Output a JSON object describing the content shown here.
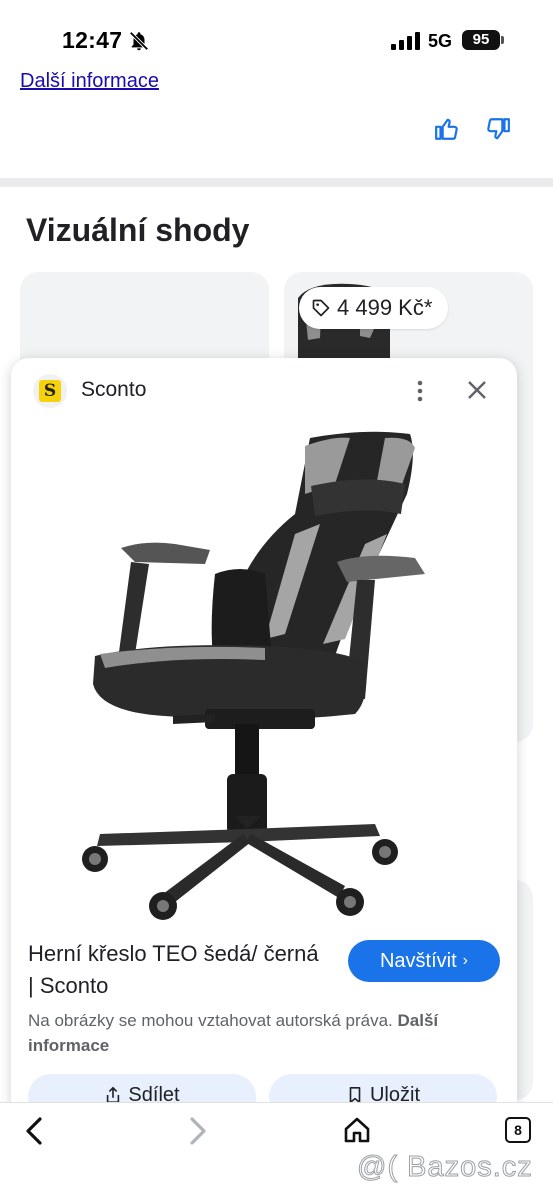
{
  "status_bar": {
    "time": "12:47",
    "network": "5G",
    "battery": "95"
  },
  "top_result": {
    "more_info_link": "Další informace"
  },
  "section": {
    "title": "Vizuální shody"
  },
  "grid": {
    "price_chip": "4 499 Kč*"
  },
  "popup": {
    "source_name": "Sconto",
    "favicon_letter": "S",
    "product_title": "Herní křeslo TEO šedá/ černá | Sconto",
    "visit_label": "Navštívit",
    "visit_chevron": "›",
    "copyright_text": "Na obrázky se mohou vztahovat autorská práva.",
    "copyright_more": "Další informace",
    "share_label": "Sdílet",
    "save_label": "Uložit"
  },
  "bottom_bar": {
    "tabs_count": "8",
    "watermark": "@( Bazos.cz"
  },
  "colors": {
    "accent": "#1a73e8",
    "chip_bg": "#e8f0fe",
    "favicon": "#f5d20a",
    "link": "#1a0dab"
  },
  "icons": [
    "bell-off-icon",
    "signal-icon",
    "thumb-up-icon",
    "thumb-down-icon",
    "tag-icon",
    "more-vert-icon",
    "close-icon",
    "share-icon",
    "bookmark-icon",
    "back-icon",
    "forward-icon",
    "home-icon",
    "tabs-icon"
  ]
}
